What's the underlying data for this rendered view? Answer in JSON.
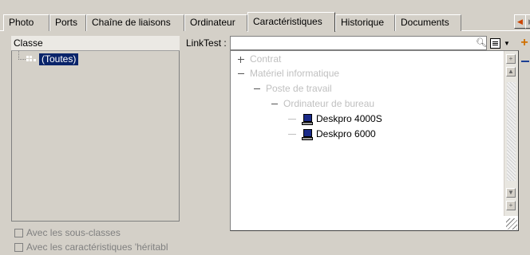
{
  "tabs": [
    {
      "label": "Photo",
      "active": false
    },
    {
      "label": "Ports",
      "active": false
    },
    {
      "label": "Chaîne de liaisons",
      "active": false
    },
    {
      "label": "Ordinateur",
      "active": false
    },
    {
      "label": "Caractéristiques",
      "active": true
    },
    {
      "label": "Historique",
      "active": false
    },
    {
      "label": "Documents",
      "active": false
    }
  ],
  "classe": {
    "header": "Classe",
    "selected_item": "(Toutes)"
  },
  "linktest": {
    "label": "LinkTest :",
    "value": ""
  },
  "tree": [
    {
      "label": "Contrat",
      "expander": "plus"
    },
    {
      "label": "Matériel informatique",
      "expander": "minus"
    },
    {
      "label": "Poste de travail",
      "expander": "minus"
    },
    {
      "label": "Ordinateur de bureau",
      "expander": "minus"
    },
    {
      "label": "Deskpro 4000S",
      "icon": "computer-icon"
    },
    {
      "label": "Deskpro 6000",
      "icon": "computer-icon"
    }
  ],
  "checkboxes": [
    {
      "label": "Avec les sous-classes",
      "checked": false
    },
    {
      "label": "Avec les caractéristiques 'héritabl",
      "checked": false
    }
  ],
  "colors": {
    "window_bg": "#d4d0c8",
    "selection_bg": "#0a246a",
    "disabled_text": "#808080",
    "add_icon": "#d07000",
    "remove_icon": "#1c3f94"
  }
}
